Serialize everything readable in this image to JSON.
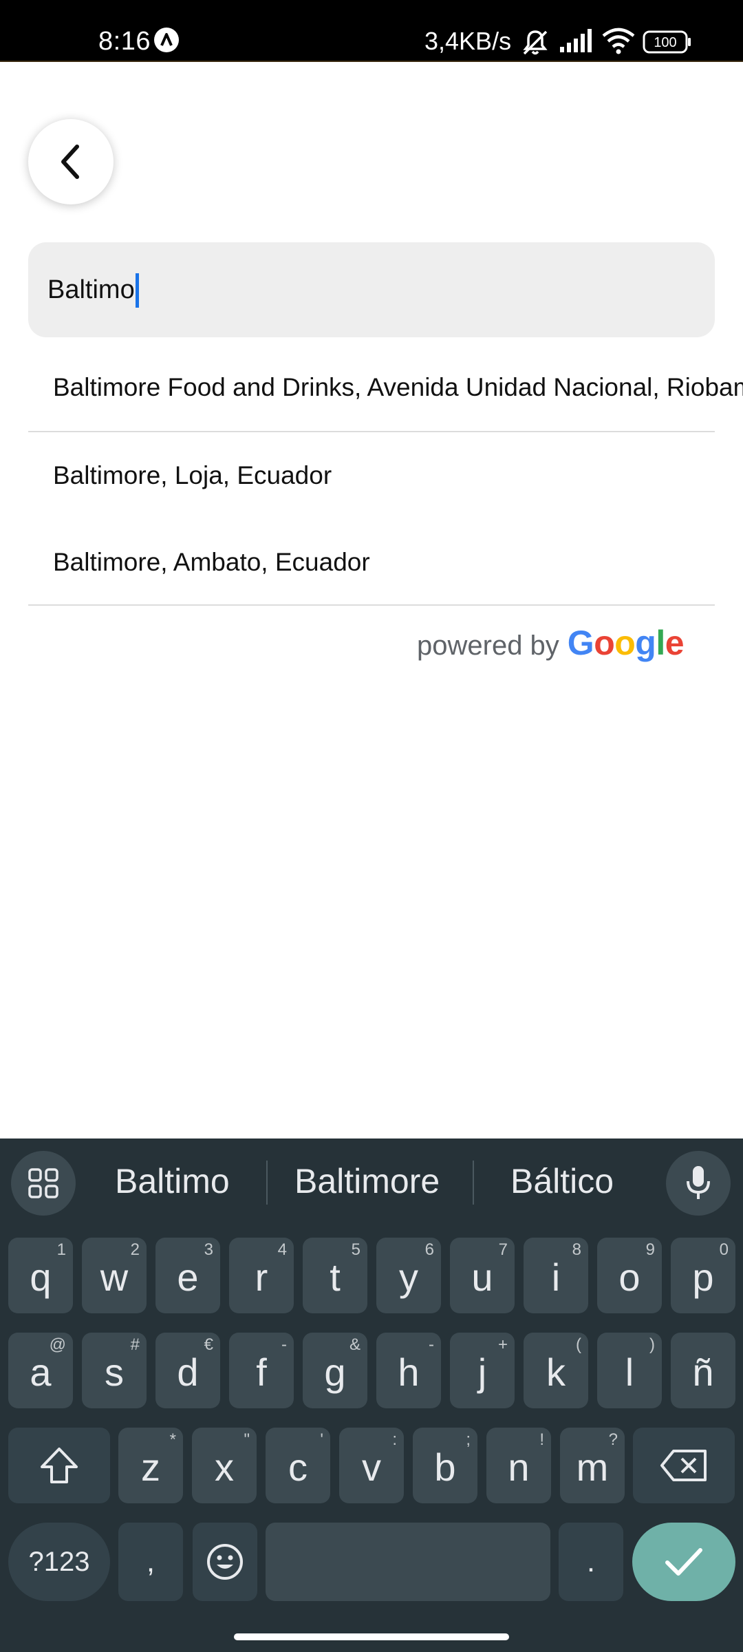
{
  "status_bar": {
    "time": "8:16",
    "network_speed": "3,4KB/s",
    "battery": "100",
    "icons": [
      "assistant-a-icon",
      "mute-icon",
      "signal-icon",
      "wifi-icon",
      "battery-icon"
    ]
  },
  "search": {
    "value": "Baltimo"
  },
  "suggestions": [
    {
      "label": "Baltimore Food and Drinks, Avenida Unidad Nacional, Riobamba, Ecuador"
    },
    {
      "label": "Baltimore, Loja, Ecuador"
    },
    {
      "label": "Baltimore, Ambato, Ecuador"
    }
  ],
  "attribution": {
    "prefix": "powered by",
    "brand_letters": [
      "G",
      "o",
      "o",
      "g",
      "l",
      "e"
    ],
    "brand_colors": [
      "#4285F4",
      "#EA4335",
      "#FBBC05",
      "#4285F4",
      "#34A853",
      "#EA4335"
    ]
  },
  "keyboard": {
    "suggestions": [
      "Baltimo",
      "Baltimore",
      "Báltico"
    ],
    "row1": [
      {
        "k": "q",
        "h": "1"
      },
      {
        "k": "w",
        "h": "2"
      },
      {
        "k": "e",
        "h": "3"
      },
      {
        "k": "r",
        "h": "4"
      },
      {
        "k": "t",
        "h": "5"
      },
      {
        "k": "y",
        "h": "6"
      },
      {
        "k": "u",
        "h": "7"
      },
      {
        "k": "i",
        "h": "8"
      },
      {
        "k": "o",
        "h": "9"
      },
      {
        "k": "p",
        "h": "0"
      }
    ],
    "row2": [
      {
        "k": "a",
        "h": "@"
      },
      {
        "k": "s",
        "h": "#"
      },
      {
        "k": "d",
        "h": "€"
      },
      {
        "k": "f",
        "h": "-"
      },
      {
        "k": "g",
        "h": "&"
      },
      {
        "k": "h",
        "h": "-"
      },
      {
        "k": "j",
        "h": "+"
      },
      {
        "k": "k",
        "h": "("
      },
      {
        "k": "l",
        "h": ")"
      },
      {
        "k": "ñ",
        "h": ""
      }
    ],
    "row3": [
      {
        "k": "z",
        "h": "*"
      },
      {
        "k": "x",
        "h": "\""
      },
      {
        "k": "c",
        "h": "'"
      },
      {
        "k": "v",
        "h": ":"
      },
      {
        "k": "b",
        "h": ";"
      },
      {
        "k": "n",
        "h": "!"
      },
      {
        "k": "m",
        "h": "?"
      }
    ],
    "symbols_label": "?123",
    "comma_label": ",",
    "period_label": ".",
    "accent_color": "#6fb1a8",
    "background_color": "#263238"
  }
}
